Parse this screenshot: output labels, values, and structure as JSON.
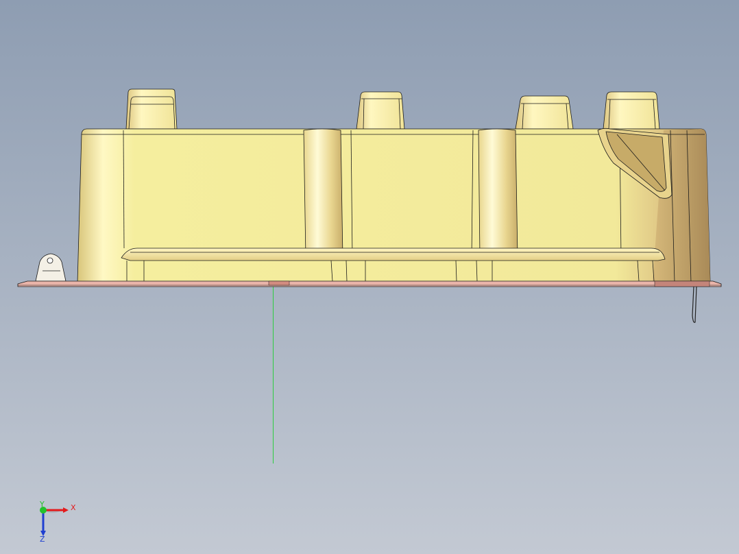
{
  "viewport": {
    "background_top": "#8e9db2",
    "background_bottom": "#c3c9d3"
  },
  "model": {
    "body_color": "#f5ee9e",
    "body_shade": "#c9aa63",
    "flange_color": "#e9b4a9",
    "edge_color": "#1a1a1a",
    "construction_line_color": "#2ecc40"
  },
  "triad": {
    "x_label": "X",
    "y_label": "Y",
    "z_label": "Z",
    "x_color": "#e31a1c",
    "y_color": "#22c22b",
    "z_color": "#1f3fd1"
  }
}
